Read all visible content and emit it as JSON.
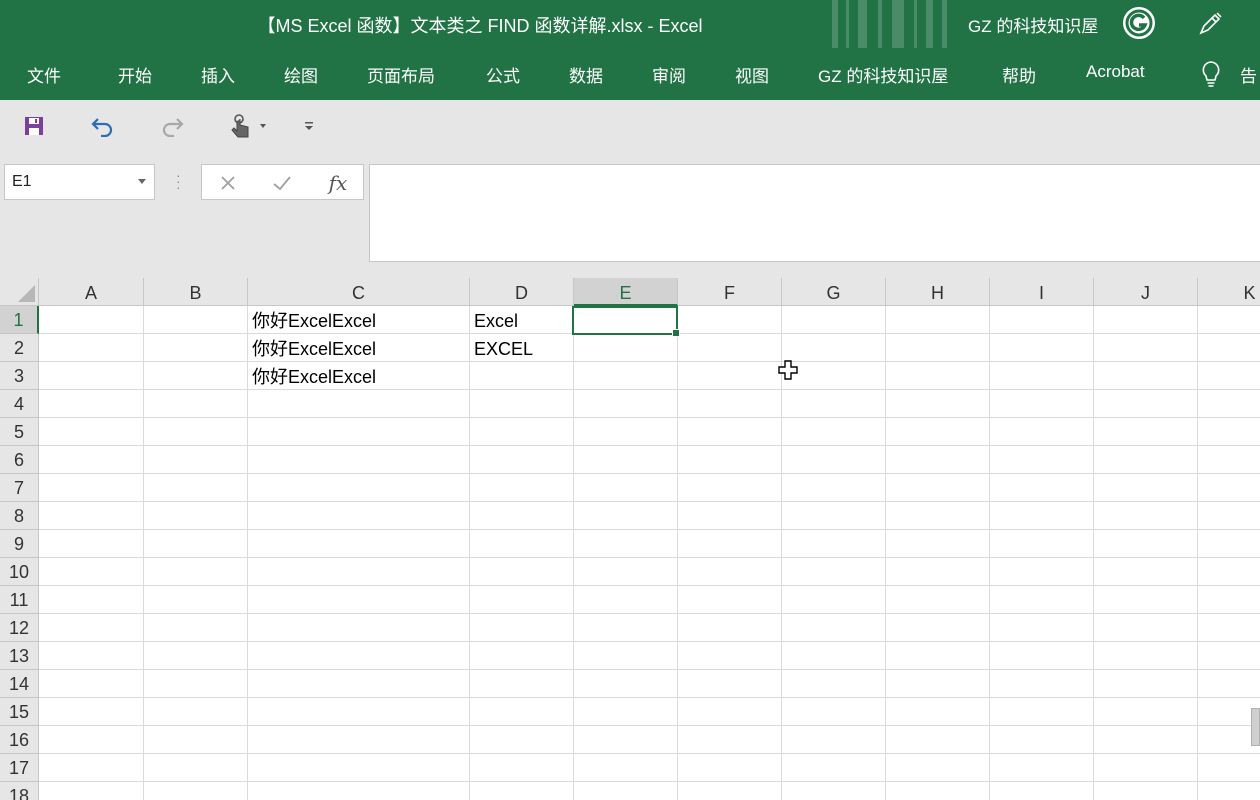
{
  "window": {
    "title": "【MS Excel 函数】文本类之 FIND 函数详解.xlsx  -  Excel",
    "user": "GZ 的科技知识屋"
  },
  "ribbon": {
    "tabs": [
      "文件",
      "开始",
      "插入",
      "绘图",
      "页面布局",
      "公式",
      "数据",
      "审阅",
      "视图",
      "GZ 的科技知识屋",
      "帮助",
      "Acrobat",
      "告"
    ]
  },
  "quick_access": {
    "icons": [
      "save-icon",
      "undo-icon",
      "redo-icon",
      "touch-mode-icon",
      "customize-dropdown-icon"
    ]
  },
  "formula_bar": {
    "name_box": "E1",
    "fx_label": "fx",
    "formula": ""
  },
  "sheet": {
    "columns": [
      "A",
      "B",
      "C",
      "D",
      "E",
      "F",
      "G",
      "H",
      "I",
      "J",
      "K"
    ],
    "rows": [
      "1",
      "2",
      "3",
      "4",
      "5",
      "6",
      "7",
      "8",
      "9",
      "10",
      "11",
      "12",
      "13",
      "14",
      "15",
      "16",
      "17",
      "18"
    ],
    "selected_cell": "E1",
    "cells": {
      "C1": "你好ExcelExcel",
      "C2": "你好ExcelExcel",
      "C3": "你好ExcelExcel",
      "D1": "Excel",
      "D2": "EXCEL"
    }
  },
  "colors": {
    "accent": "#217346",
    "ribbon_bg": "#217346",
    "toolbar_bg": "#e6e6e6",
    "header_bg": "#e6e6e6",
    "gridline": "#dadada"
  }
}
